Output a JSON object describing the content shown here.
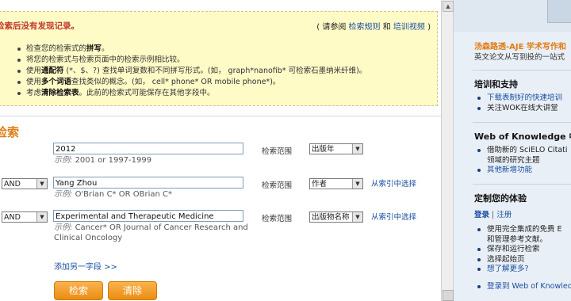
{
  "notice": {
    "title": "检索后没有发现记录。",
    "help_open": "( 请参阅",
    "help_rules": "检索规则",
    "help_and": "和",
    "help_video": "培训视频",
    "help_close": ")",
    "tips": [
      {
        "pre": "检查您的检索式的",
        "bold": "拼写",
        "post": "。"
      },
      {
        "pre": "将您的检索式与检索页面中的检索示例相比较。",
        "bold": "",
        "post": ""
      },
      {
        "pre": "使用",
        "bold": "通配符",
        "post": " (*、$、?) 查找单词复数和不同拼写形式。(如，  graph*nanofib* 可检索石墨纳米纤维)。"
      },
      {
        "pre": "使用",
        "bold": "多个词语",
        "post": "查找类似的概念。(如，  cell* phone* OR mobile phone*)。"
      },
      {
        "pre": "考虑",
        "bold": "清除检索表",
        "post": "。此前的检索式可能保存在其他字段中。"
      }
    ]
  },
  "search": {
    "section_title": "检索",
    "scope_label": "检索范围",
    "index_link": "从索引中选择",
    "rows": [
      {
        "operator": "",
        "value": "2012",
        "example_prefix": "示例:",
        "example": "2001 or 1997-1999",
        "scope": "出版年"
      },
      {
        "operator": "AND",
        "value": "Yang Zhou",
        "example_prefix": "示例:",
        "example": "O'Brian C* OR OBrian C*",
        "scope": "作者"
      },
      {
        "operator": "AND",
        "value": "Experimental and Therapeutic Medicine",
        "example_prefix": "示例:",
        "example": "Cancer* OR Journal of Cancer Research and Clinical Oncology",
        "scope": "出版物名称"
      }
    ],
    "add_field": "添加另一字段 >>",
    "search_button": "检索",
    "clear_button": "清除"
  },
  "sidebar": {
    "ad_title": "汤森路透-AJE 学术写作和",
    "ad_sub": "英文论文从写到投的一站式",
    "training_title": "培训和支持",
    "training_items": [
      "下载表制好的快速培训",
      "关注WOK在线大讲堂"
    ],
    "wok_title": "Web of Knowledge 中国",
    "wok_items": [
      {
        "text": "借助新的 SciELO Citati",
        "link": false,
        "cont": false
      },
      {
        "text": "领域的研究主题",
        "link": false,
        "cont": true
      },
      {
        "text": "其他新增功能",
        "link": true,
        "cont": false
      }
    ],
    "custom_title": "定制您的体验",
    "login": "登录",
    "divider": "|",
    "register": "注册",
    "custom_items": [
      {
        "text": "使用完全集成的免费 E",
        "link": false,
        "cont": false
      },
      {
        "text": "和管理参考文献。",
        "link": false,
        "cont": true
      },
      {
        "text": "保存和运行检索",
        "link": false,
        "cont": false
      },
      {
        "text": "选择起始页",
        "link": false,
        "cont": false
      },
      {
        "text": "想了解更多?",
        "link": true,
        "cont": false
      }
    ],
    "login_wok": "登录到 Web of Knowled"
  },
  "icons": {
    "dropdown": "chevron-down-icon",
    "scroll_up": "arrow-up-icon"
  },
  "colors": {
    "accent": "#e07b12",
    "link": "#1a4fa0",
    "notice_bg": "#fffbc7",
    "error": "#c0392b"
  }
}
